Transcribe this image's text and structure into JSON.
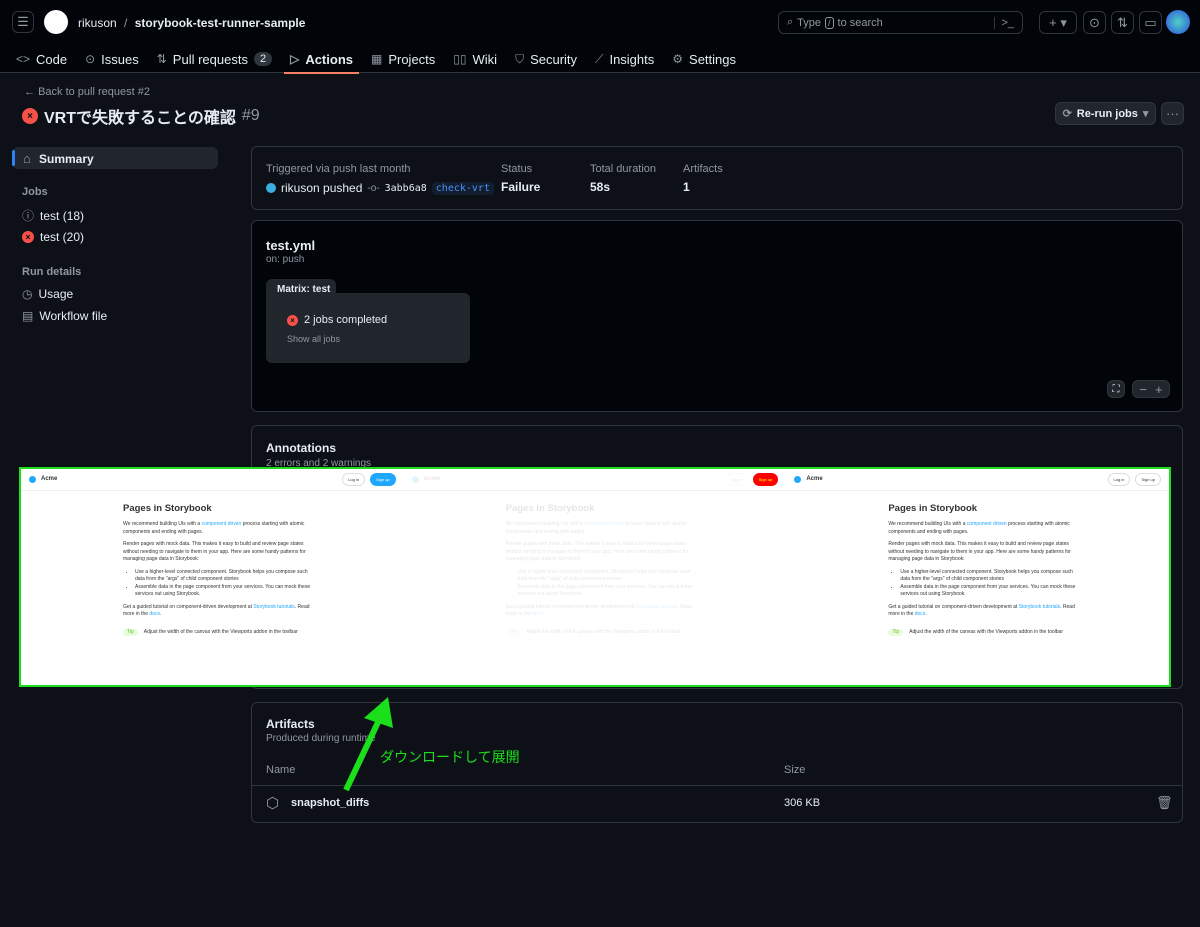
{
  "header": {
    "owner": "rikuson",
    "repo": "storybook-test-runner-sample",
    "search_placeholder": "Type / to search",
    "search_prefix": "Type",
    "search_key": "/",
    "search_suffix": "to search"
  },
  "nav": [
    {
      "label": "Code",
      "icon": "code-icon"
    },
    {
      "label": "Issues",
      "icon": "issue-icon"
    },
    {
      "label": "Pull requests",
      "icon": "pr-icon",
      "count": "2"
    },
    {
      "label": "Actions",
      "icon": "play-icon",
      "active": true
    },
    {
      "label": "Projects",
      "icon": "table-icon"
    },
    {
      "label": "Wiki",
      "icon": "book-icon"
    },
    {
      "label": "Security",
      "icon": "shield-icon"
    },
    {
      "label": "Insights",
      "icon": "graph-icon"
    },
    {
      "label": "Settings",
      "icon": "gear-icon"
    }
  ],
  "run": {
    "back": "Back to pull request #2",
    "title": "VRTで失敗することの確認",
    "number": "#9",
    "rerun": "Re-run jobs"
  },
  "sidebar": {
    "summary": "Summary",
    "jobs_heading": "Jobs",
    "jobs": [
      {
        "label": "test (18)",
        "status": "neutral"
      },
      {
        "label": "test (20)",
        "status": "failure"
      }
    ],
    "run_details_heading": "Run details",
    "details": [
      {
        "label": "Usage",
        "icon": "stopwatch-icon"
      },
      {
        "label": "Workflow file",
        "icon": "file-icon"
      }
    ]
  },
  "summary": {
    "trigger_label": "Triggered via push last month",
    "actor": "rikuson pushed",
    "commit": "3abb6a8",
    "branch": "check-vrt",
    "status_label": "Status",
    "status": "Failure",
    "duration_label": "Total duration",
    "duration": "58s",
    "artifacts_label": "Artifacts",
    "artifacts": "1"
  },
  "workflow": {
    "file": "test.yml",
    "trigger": "on: push",
    "matrix": "Matrix: test",
    "jobs_completed": "2 jobs completed",
    "show_all": "Show all jobs"
  },
  "annotations": {
    "title": "Annotations",
    "subtitle": "2 errors and 2 warnings"
  },
  "artifacts": {
    "title": "Artifacts",
    "subtitle": "Produced during runtime",
    "col_name": "Name",
    "col_size": "Size",
    "items": [
      {
        "name": "snapshot_diffs",
        "size": "306 KB"
      }
    ]
  },
  "overlay": {
    "brand": "Acme",
    "login": "Log in",
    "signup": "Sign up",
    "heading": "Pages in Storybook",
    "p1a": "We recommend building UIs with a ",
    "p1link": "component driven",
    "p1b": " process starting with atomic components and ending with pages.",
    "p2": "Render pages with mock data. This makes it easy to build and review page states without needing to navigate to them in your app. Here are some handy patterns for managing page data in Storybook:",
    "li1": "Use a higher-level connected component. Storybook helps you compose such data from the \"args\" of child component stories",
    "li2": "Assemble data in the page component from your services. You can mock these services out using Storybook.",
    "p3a": "Get a guided tutorial on component-driven development at ",
    "p3link": "Storybook tutorials",
    "p3b": ". Read more in the ",
    "p3link2": "docs",
    "p3c": ".",
    "tip": "Tip",
    "tip_text": "Adjust the width of the canvas with the Viewports addon in the toolbar"
  },
  "annotation_note": {
    "text": "ダウンロードして展開",
    "color": "#1adf1a"
  }
}
